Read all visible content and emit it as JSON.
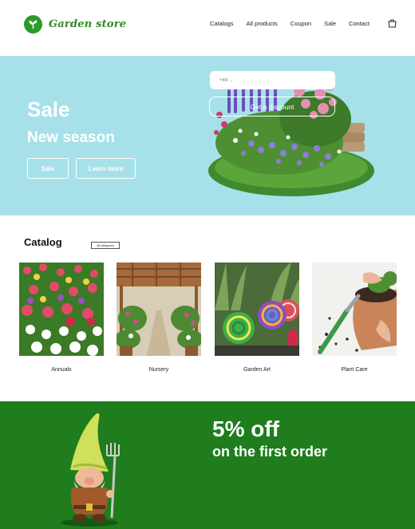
{
  "header": {
    "logo_text": "Garden store",
    "nav": [
      "Catalogs",
      "All products",
      "Coupon",
      "Sale",
      "Contact"
    ],
    "cart_icon": "shopping-bag-icon"
  },
  "hero": {
    "title": "Sale",
    "subtitle": "New season",
    "sale_button": "Sale",
    "more_button": "Learn more"
  },
  "catalog": {
    "title": "Catalog",
    "all_button": "All categories",
    "items": [
      {
        "label": "Annuals"
      },
      {
        "label": "Nursery"
      },
      {
        "label": "Garden Art"
      },
      {
        "label": "Plant Care"
      }
    ]
  },
  "promo": {
    "headline": "5% off",
    "subheadline": "on the first order",
    "phone_placeholder": "+49 ...",
    "button": "Get a discount"
  },
  "colors": {
    "brand_green": "#2e9a2a",
    "hero_bg": "#a6e1ea",
    "promo_bg": "#1f7d1e"
  }
}
